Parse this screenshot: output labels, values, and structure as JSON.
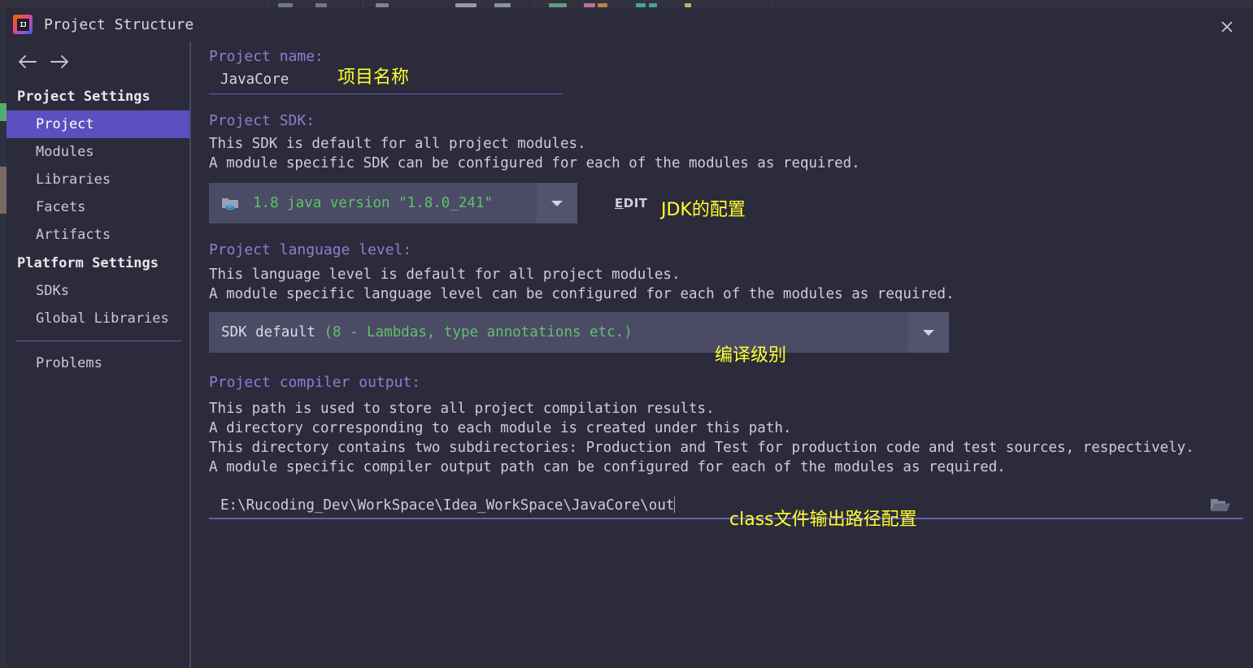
{
  "window": {
    "title": "Project Structure",
    "logo_text": "IJ",
    "close_label": "×"
  },
  "nav": {
    "back": "←",
    "forward": "→"
  },
  "sidebar": {
    "groups": [
      {
        "title": "Project Settings",
        "items": [
          {
            "label": "Project",
            "selected": true
          },
          {
            "label": "Modules",
            "selected": false
          },
          {
            "label": "Libraries",
            "selected": false
          },
          {
            "label": "Facets",
            "selected": false
          },
          {
            "label": "Artifacts",
            "selected": false
          }
        ]
      },
      {
        "title": "Platform Settings",
        "items": [
          {
            "label": "SDKs",
            "selected": false
          },
          {
            "label": "Global Libraries",
            "selected": false
          }
        ]
      }
    ],
    "extra_items": [
      {
        "label": "Problems",
        "selected": false
      }
    ]
  },
  "main": {
    "project_name": {
      "label": "Project name:",
      "value": "JavaCore"
    },
    "project_sdk": {
      "label": "Project SDK:",
      "desc_line1": "This SDK is default for all project modules.",
      "desc_line2": "A module specific SDK can be configured for each of the modules as required.",
      "selected": "1.8 java version \"1.8.0_241\"",
      "icon": "java-folder-icon",
      "dropdown_arrow": "▼",
      "edit_button": "EDIT",
      "edit_mnemonic": "E",
      "edit_rest": "DIT"
    },
    "language_level": {
      "label": "Project language level:",
      "desc_line1": "This language level is default for all project modules.",
      "desc_line2": "A module specific language level can be configured for each of the modules as required.",
      "selected_plain": "SDK default ",
      "selected_green": "(8 - Lambdas, type annotations etc.)",
      "dropdown_arrow": "▼"
    },
    "compiler_output": {
      "label": "Project compiler output:",
      "desc_line1": "This path is used to store all project compilation results.",
      "desc_line2": "A directory corresponding to each module is created under this path.",
      "desc_line3": "This directory contains two subdirectories: Production and Test for production code and test sources, respectively.",
      "desc_line4": "A module specific compiler output path can be configured for each of the modules as required.",
      "value": "E:\\Rucoding_Dev\\WorkSpace\\Idea_WorkSpace\\JavaCore\\out",
      "browse_icon": "folder-open-icon"
    }
  },
  "annotations": [
    {
      "id": "anno-name",
      "text": "项目名称"
    },
    {
      "id": "anno-jdk",
      "text": "JDK的配置"
    },
    {
      "id": "anno-lang",
      "text": "编译级别"
    },
    {
      "id": "anno-out",
      "text": "class文件输出路径配置"
    }
  ],
  "colors": {
    "dialog_bg": "#2b2b3b",
    "selected_item": "#5c4fc0",
    "section_label": "#8b7fd4",
    "combo_bg": "#4b4b66",
    "green_text": "#5ec269",
    "annotation": "#ffff2e",
    "underline": "#6a5ab5"
  }
}
